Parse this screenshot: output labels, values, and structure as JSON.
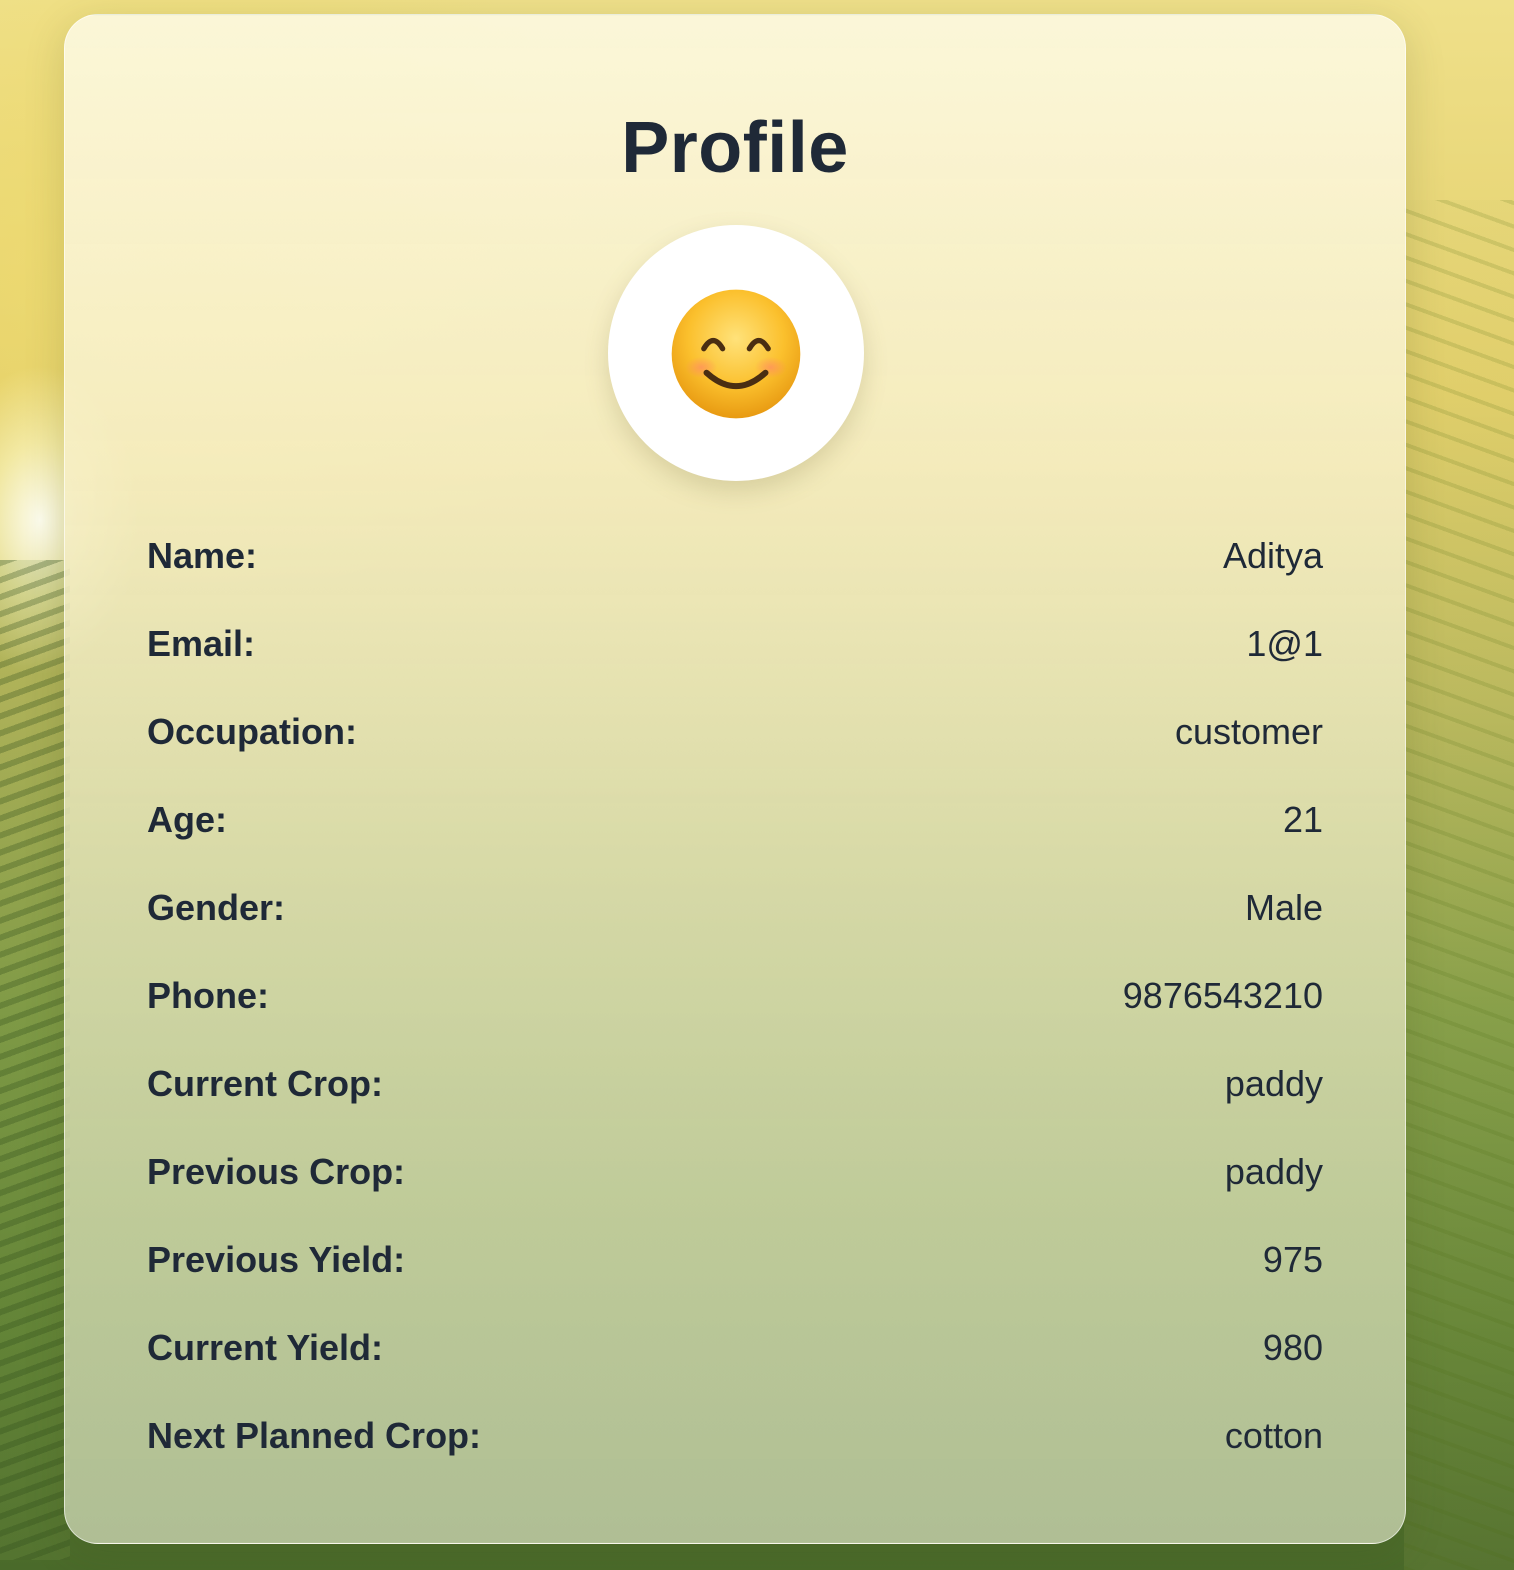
{
  "profile": {
    "title": "Profile",
    "avatar_icon": "smiling-face-icon",
    "fields": [
      {
        "label": "Name:",
        "value": "Aditya"
      },
      {
        "label": "Email:",
        "value": "1@1"
      },
      {
        "label": "Occupation:",
        "value": "customer"
      },
      {
        "label": "Age:",
        "value": "21"
      },
      {
        "label": "Gender:",
        "value": "Male"
      },
      {
        "label": "Phone:",
        "value": "9876543210"
      },
      {
        "label": "Current Crop:",
        "value": "paddy"
      },
      {
        "label": "Previous Crop:",
        "value": "paddy"
      },
      {
        "label": "Previous Yield:",
        "value": "975"
      },
      {
        "label": "Current Yield:",
        "value": "980"
      },
      {
        "label": "Next Planned Crop:",
        "value": "cotton"
      }
    ]
  },
  "colors": {
    "text": "#1f2937",
    "avatar_bg": "#ffffff",
    "emoji_face": "#f7b52a"
  }
}
